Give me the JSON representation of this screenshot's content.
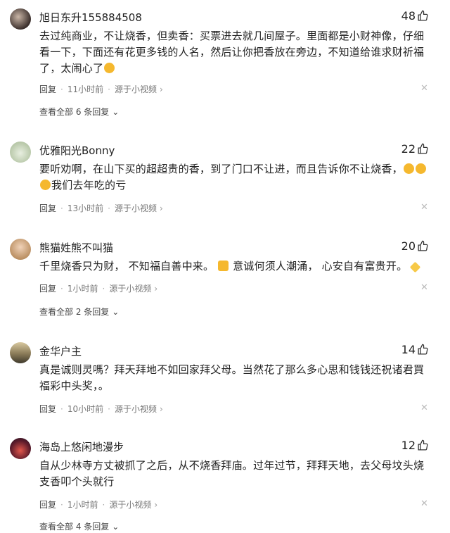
{
  "comments": [
    {
      "username": "旭日东升155884508",
      "likes": "48",
      "content": "去过纯商业，不让烧香，但卖香：买票进去就几间屋子。里面都是小财神像，仔细看一下，下面还有花更多钱的人名，然后让你把香放在旁边，不知道给谁求财祈福了，太闹心了",
      "reply_label": "回复",
      "time": "11小时前",
      "source": "源于小视频",
      "view_all": "查看全部 6 条回复"
    },
    {
      "username": "优雅阳光Bonny",
      "likes": "22",
      "content_a": "要听劝啊，在山下买的超超贵的香，到了门口不让进，而且告诉你不让烧香，",
      "content_b": "我们去年吃的亏",
      "reply_label": "回复",
      "time": "13小时前",
      "source": "源于小视频"
    },
    {
      "username": "熊猫姓熊不叫猫",
      "likes": "20",
      "content_a": "千里烧香只为财， 不知福自善中来。",
      "content_b": "意诚何须人潮涌， 心安自有富贵开。",
      "reply_label": "回复",
      "time": "1小时前",
      "source": "源于小视频",
      "view_all": "查看全部 2 条回复"
    },
    {
      "username": "金华户主",
      "likes": "14",
      "content": "真是诚则灵嗎？拜天拜地不如回家拜父母。当然花了那么多心思和钱钱还祝诸君買福彩中头奖，。",
      "reply_label": "回复",
      "time": "10小时前",
      "source": "源于小视频"
    },
    {
      "username": "海岛上悠闲地漫步",
      "likes": "12",
      "content": "自从少林寺方丈被抓了之后，从不烧香拜庙。过年过节，拜拜天地，去父母坟头烧支香叩个头就行",
      "reply_label": "回复",
      "time": "1小时前",
      "source": "源于小视频",
      "view_all": "查看全部 4 条回复"
    }
  ],
  "colors": {
    "text": "#222222",
    "meta": "#777777",
    "emoji": "#f5b82e"
  }
}
